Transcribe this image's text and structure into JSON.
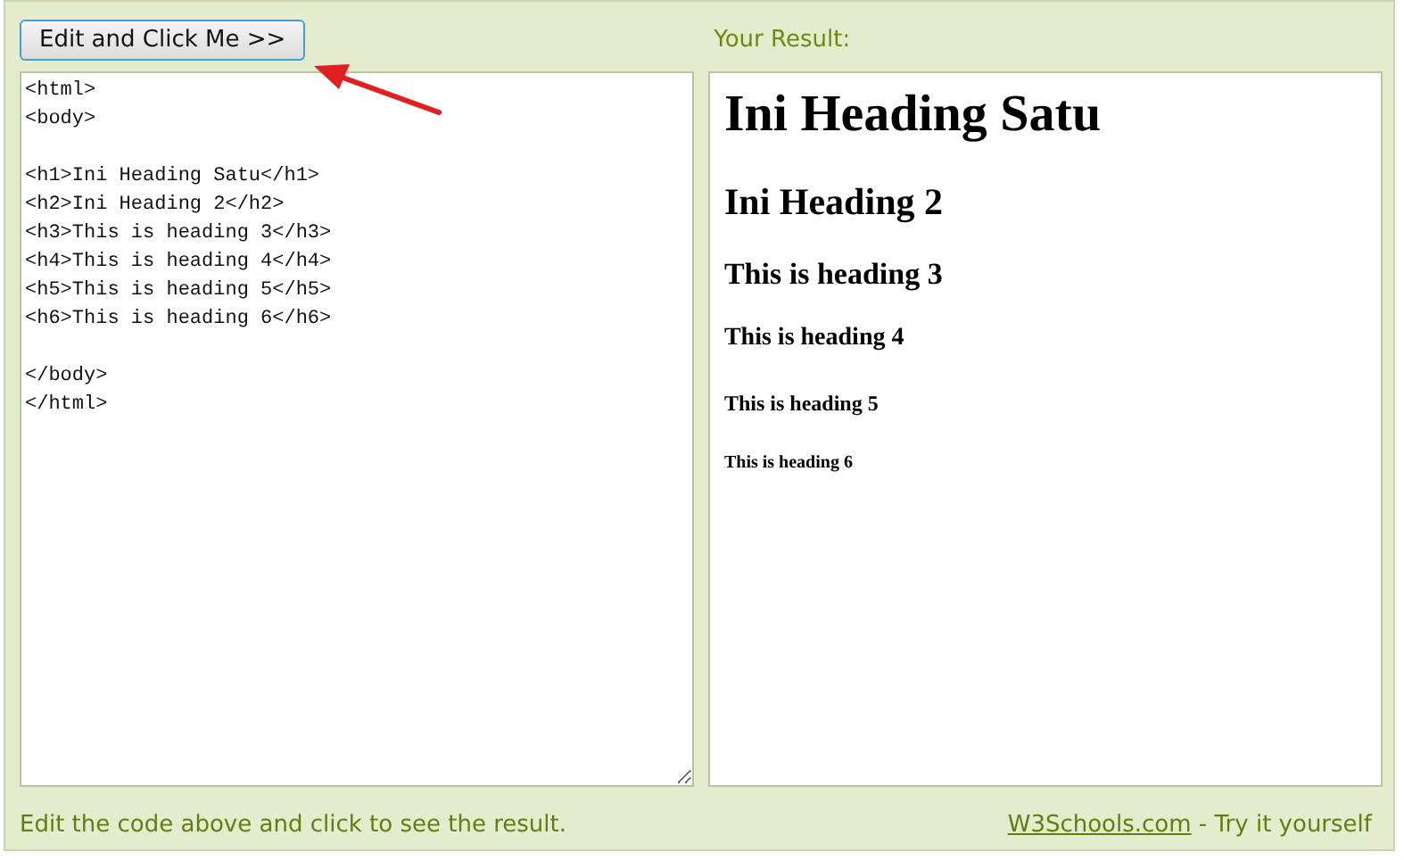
{
  "toolbar": {
    "button": "Edit and Click Me >>",
    "result_label": "Your Result:"
  },
  "editor": {
    "blocks": [
      [
        "<html>",
        "<body>"
      ],
      [
        "<h1>Ini Heading Satu</h1>",
        "<h2>Ini Heading 2</h2>",
        "<h3>This is heading 3</h3>",
        "<h4>This is heading 4</h4>",
        "<h5>This is heading 5</h5>",
        "<h6>This is heading 6</h6>"
      ],
      [
        "</body>",
        "</html>"
      ]
    ]
  },
  "result": {
    "headings": [
      {
        "kind": "h1",
        "text": "Ini Heading Satu"
      },
      {
        "kind": "h2",
        "text": "Ini Heading 2"
      },
      {
        "kind": "h3",
        "text": "This is heading 3"
      },
      {
        "kind": "h4",
        "text": "This is heading 4"
      },
      {
        "kind": "h5",
        "text": "This is heading 5"
      },
      {
        "kind": "h6",
        "text": "This is heading 6"
      }
    ]
  },
  "footer": {
    "hint": "Edit the code above and click to see the result.",
    "link": "W3Schools.com",
    "tagline": " - Try it yourself"
  }
}
